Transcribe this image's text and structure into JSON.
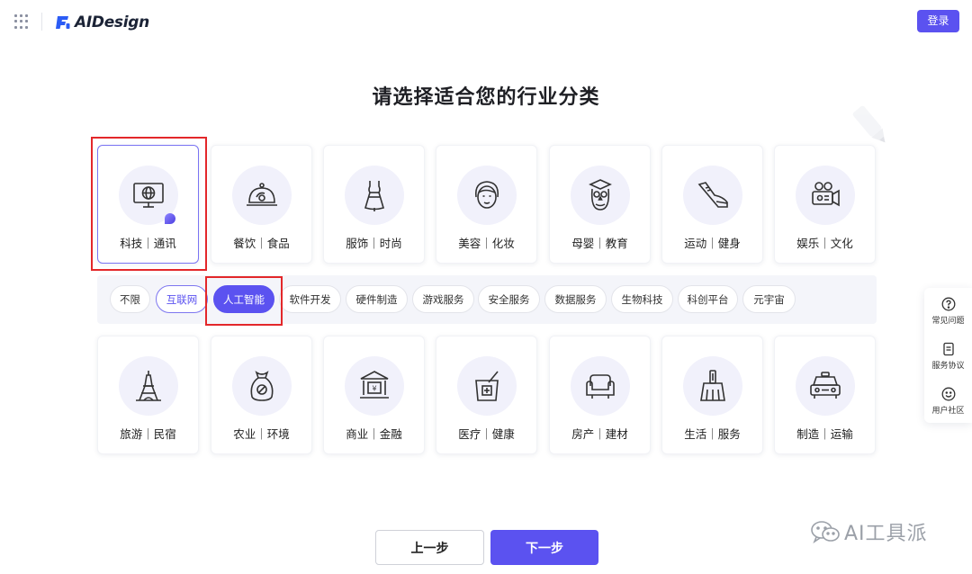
{
  "header": {
    "brand": "AIDesign",
    "login_label": "登录"
  },
  "page_title": "请选择适合您的行业分类",
  "categories_row1": [
    {
      "label": "科技｜通讯",
      "icon": "monitor-globe-icon",
      "selected": true
    },
    {
      "label": "餐饮｜食品",
      "icon": "food-cloche-icon"
    },
    {
      "label": "服饰｜时尚",
      "icon": "dress-icon"
    },
    {
      "label": "美容｜化妆",
      "icon": "face-icon"
    },
    {
      "label": "母婴｜教育",
      "icon": "owl-icon"
    },
    {
      "label": "运动｜健身",
      "icon": "sneaker-icon"
    },
    {
      "label": "娱乐｜文化",
      "icon": "video-camera-icon"
    }
  ],
  "subcategories": [
    {
      "label": "不限"
    },
    {
      "label": "互联网",
      "state": "outlined"
    },
    {
      "label": "人工智能",
      "state": "active"
    },
    {
      "label": "软件开发"
    },
    {
      "label": "硬件制造"
    },
    {
      "label": "游戏服务"
    },
    {
      "label": "安全服务"
    },
    {
      "label": "数据服务"
    },
    {
      "label": "生物科技"
    },
    {
      "label": "科创平台"
    },
    {
      "label": "元宇宙"
    }
  ],
  "categories_row2": [
    {
      "label": "旅游｜民宿",
      "icon": "eiffel-tower-icon"
    },
    {
      "label": "农业｜环境",
      "icon": "grain-sack-icon"
    },
    {
      "label": "商业｜金融",
      "icon": "bank-icon"
    },
    {
      "label": "医疗｜健康",
      "icon": "medical-mortar-icon"
    },
    {
      "label": "房产｜建材",
      "icon": "sofa-icon"
    },
    {
      "label": "生活｜服务",
      "icon": "broom-icon"
    },
    {
      "label": "制造｜运输",
      "icon": "car-icon"
    }
  ],
  "side_panel": {
    "faq": "常见问题",
    "agreement": "服务协议",
    "community": "用户社区"
  },
  "footer": {
    "prev_label": "上一步",
    "next_label": "下一步"
  },
  "watermark": "AI工具派",
  "colors": {
    "accent": "#5b52f0",
    "highlight": "#e3272a"
  }
}
